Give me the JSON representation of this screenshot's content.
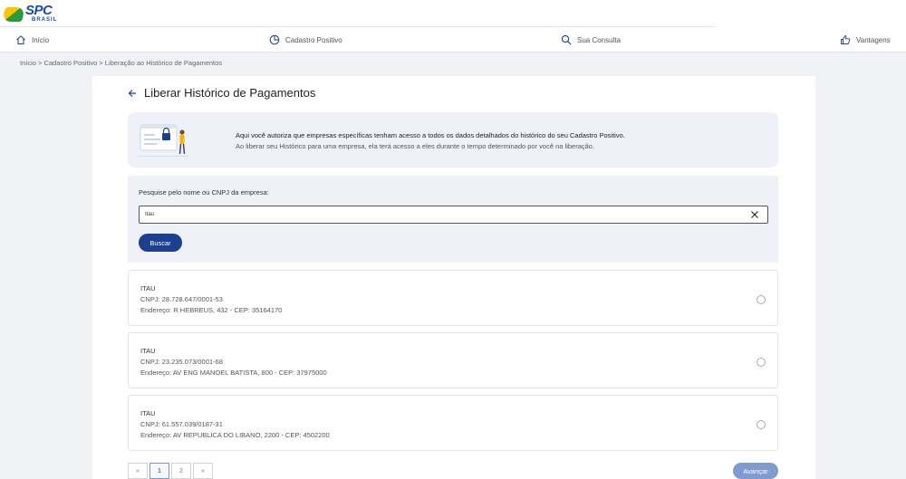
{
  "brand": {
    "name": "SPC",
    "sub": "BRASIL"
  },
  "nav": {
    "inicio": "Início",
    "cadastro": "Cadastro Positivo",
    "consulta": "Sua Consulta",
    "vantagens": "Vantagens"
  },
  "breadcrumb": "Início > Cadastro Positivo > Liberação ao Histórico de Pagamentos",
  "page": {
    "title": "Liberar Histórico de Pagamentos"
  },
  "info": {
    "line1": "Aqui você autoriza que empresas específicas tenham acesso a todos os dados detalhados do histórico do seu Cadastro Positivo.",
    "line2": "Ao liberar seu Histórico para uma empresa, ela terá acesso a eles durante o tempo determinado por você na liberação."
  },
  "search": {
    "label": "Pesquise pelo nome ou CNPJ da empresa:",
    "value": "Itau",
    "button": "Buscar"
  },
  "results": [
    {
      "name": "ITAU",
      "cnpj": "CNPJ: 28.728.647/0001-53",
      "address": "Endereço: R HEBREUS, 432 - CEP: 35164170"
    },
    {
      "name": "ITAU",
      "cnpj": "CNPJ: 23.235.073/0001-68",
      "address": "Endereço: AV ENG MANOEL BATISTA, 800 - CEP: 37975000"
    },
    {
      "name": "ITAU",
      "cnpj": "CNPJ: 61.557.039/0187-31",
      "address": "Endereço: AV REPUBLICA DO LIBANO, 2200 - CEP: 4502200"
    }
  ],
  "pagination": {
    "prev": "«",
    "pages": [
      "1",
      "2"
    ],
    "next": "»"
  },
  "actions": {
    "next": "Avançar"
  },
  "colors": {
    "primary": "#1d3f8f",
    "disabled": "#7f9bcf",
    "panel": "#eef2f8",
    "brand_yellow": "#f7c600",
    "brand_green": "#2c9a3b"
  }
}
